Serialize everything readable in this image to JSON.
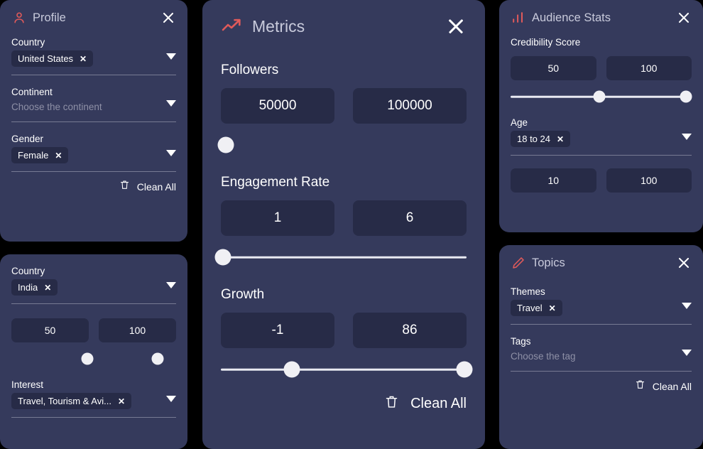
{
  "theme": {
    "page_background": "#000000",
    "panel_background": "#353a5c",
    "field_background": "#272b47",
    "accent": "#e05a5a",
    "text_primary": "#ffffff",
    "text_muted": "#8e90a6",
    "title_color": "#c8cadb",
    "knob_color": "#f0f0f4"
  },
  "panels": {
    "profile": {
      "title": "Profile",
      "icon": "user-icon",
      "close_icon": "close-icon",
      "fields": {
        "country": {
          "label": "Country",
          "caret_icon": "chevron-down-icon",
          "chips": [
            {
              "label": "United States",
              "remove_icon": "chip-remove-icon"
            }
          ]
        },
        "continent": {
          "label": "Continent",
          "caret_icon": "chevron-down-icon",
          "placeholder": "Choose the continent"
        },
        "gender": {
          "label": "Gender",
          "caret_icon": "chevron-down-icon",
          "chips": [
            {
              "label": "Female",
              "remove_icon": "chip-remove-icon"
            }
          ]
        }
      },
      "clean_all": {
        "label": "Clean All",
        "icon": "trash-icon"
      }
    },
    "country_extra": {
      "fields": {
        "country": {
          "label": "Country",
          "caret_icon": "chevron-down-icon",
          "chips": [
            {
              "label": "India",
              "remove_icon": "chip-remove-icon"
            }
          ]
        },
        "range": {
          "min_value": "50",
          "max_value": "100",
          "slider": {
            "min_percent": 46,
            "max_percent": 89,
            "track_visible": false
          }
        },
        "interest": {
          "label": "Interest",
          "caret_icon": "chevron-down-icon",
          "chips": [
            {
              "label": "Travel, Tourism & Avi...",
              "remove_icon": "chip-remove-icon"
            }
          ]
        }
      }
    },
    "metrics": {
      "title": "Metrics",
      "icon": "trending-up-icon",
      "close_icon": "close-icon",
      "groups": {
        "followers": {
          "label": "Followers",
          "min_value": "50000",
          "max_value": "100000",
          "slider": {
            "min_percent": 2,
            "max_percent": 2,
            "track_visible": false
          }
        },
        "engagement_rate": {
          "label": "Engagement Rate",
          "min_value": "1",
          "max_value": "6",
          "slider": {
            "min_percent": 1,
            "max_percent": 1,
            "track_visible": true
          }
        },
        "growth": {
          "label": "Growth",
          "min_value": "-1",
          "max_value": "86",
          "slider": {
            "min_percent": 29,
            "max_percent": 99,
            "track_visible": true
          }
        }
      },
      "clean_all": {
        "label": "Clean All",
        "icon": "trash-icon"
      }
    },
    "audience_stats": {
      "title": "Audience Stats",
      "icon": "bar-chart-icon",
      "close_icon": "close-icon",
      "groups": {
        "credibility_score": {
          "label": "Credibility Score",
          "min_value": "50",
          "max_value": "100",
          "slider": {
            "min_percent": 49,
            "max_percent": 97,
            "track_visible": true
          }
        },
        "age": {
          "label": "Age",
          "caret_icon": "chevron-down-icon",
          "chips": [
            {
              "label": "18 to 24",
              "remove_icon": "chip-remove-icon"
            }
          ],
          "min_value": "10",
          "max_value": "100"
        }
      }
    },
    "topics": {
      "title": "Topics",
      "icon": "pencil-icon",
      "close_icon": "close-icon",
      "fields": {
        "themes": {
          "label": "Themes",
          "caret_icon": "chevron-down-icon",
          "chips": [
            {
              "label": "Travel",
              "remove_icon": "chip-remove-icon"
            }
          ]
        },
        "tags": {
          "label": "Tags",
          "caret_icon": "chevron-down-icon",
          "placeholder": "Choose the tag"
        }
      },
      "clean_all": {
        "label": "Clean All",
        "icon": "trash-icon"
      }
    }
  }
}
